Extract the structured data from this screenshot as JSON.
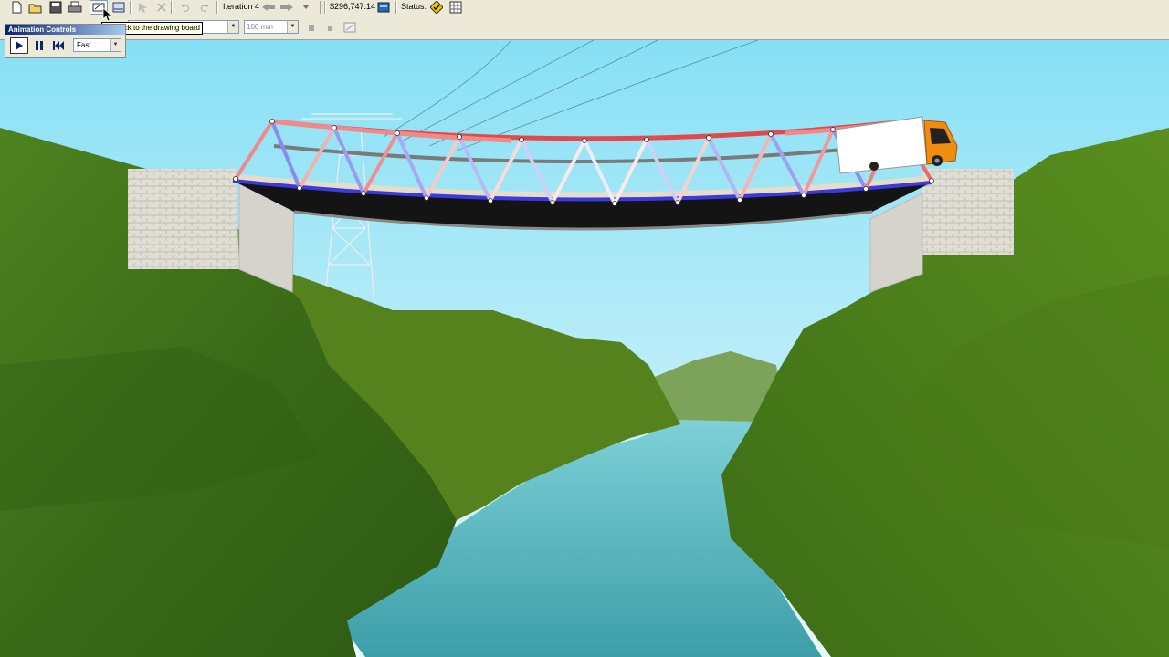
{
  "toolbar": {
    "iteration_label": "Iteration 4",
    "cost": "$296,747.14",
    "status_label": "Status:",
    "size_value": "100 mm"
  },
  "animation_controls": {
    "title": "Animation Controls",
    "speed": "Fast",
    "speed_options": [
      "Fast"
    ]
  },
  "tooltip": "Go back to the drawing board",
  "icons": [
    "new-icon",
    "open-icon",
    "save-icon",
    "print-icon",
    "drawing-board-icon",
    "load-test-icon",
    "select-icon",
    "delete-icon",
    "undo-icon",
    "redo-icon",
    "back-iteration-icon",
    "forward-iteration-icon",
    "cost-report-icon",
    "status-ok-icon",
    "grid-icon",
    "play-icon",
    "pause-icon",
    "rewind-icon"
  ],
  "colors": {
    "sky": "#8fe3f5",
    "compression": "#e84040",
    "tension": "#4040e8",
    "hill": "#4a7a1a",
    "river": "#4aa8b4",
    "truck_cab": "#f08c10"
  }
}
